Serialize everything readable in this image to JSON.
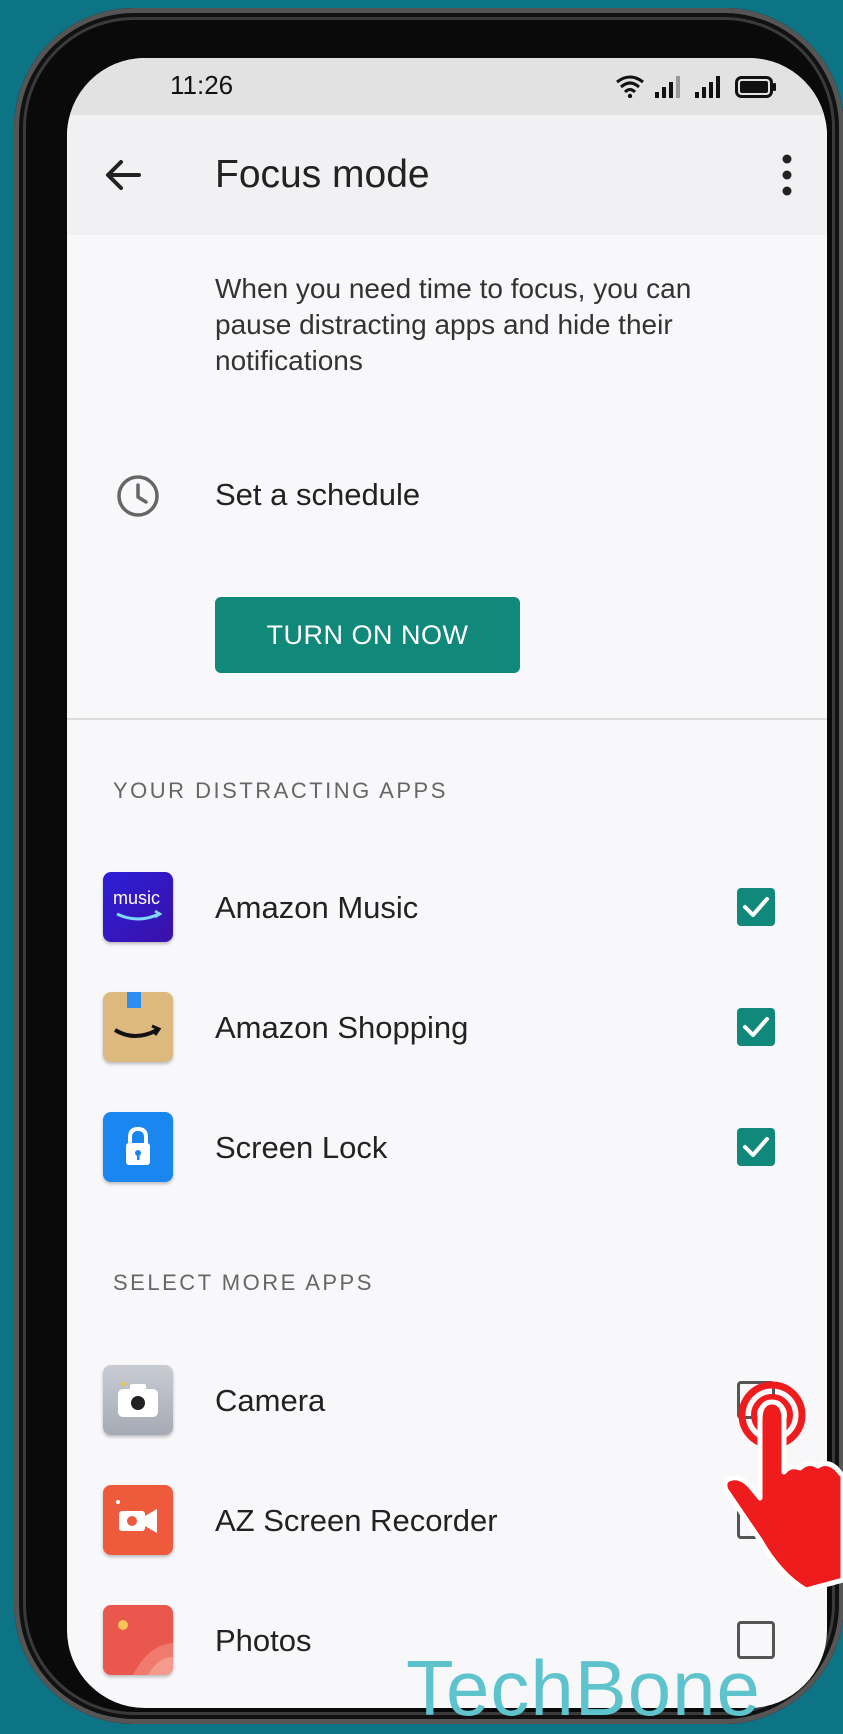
{
  "status_bar": {
    "time": "11:26"
  },
  "app_bar": {
    "title": "Focus mode"
  },
  "intro_text": "When you need time to focus, you can pause distracting apps and hide their notifications",
  "schedule": {
    "label": "Set a schedule"
  },
  "turn_on_button": {
    "label": "TURN ON NOW"
  },
  "distracting_section": {
    "header": "YOUR DISTRACTING APPS",
    "apps": [
      {
        "name": "Amazon Music",
        "checked": true,
        "icon": "amazon-music-icon",
        "icon_text": "music"
      },
      {
        "name": "Amazon Shopping",
        "checked": true,
        "icon": "amazon-shopping-icon"
      },
      {
        "name": "Screen Lock",
        "checked": true,
        "icon": "screen-lock-icon"
      }
    ]
  },
  "more_section": {
    "header": "SELECT MORE APPS",
    "apps": [
      {
        "name": "Camera",
        "checked": false,
        "icon": "camera-icon"
      },
      {
        "name": "AZ Screen Recorder",
        "checked": false,
        "icon": "az-screen-recorder-icon"
      },
      {
        "name": "Photos",
        "checked": false,
        "icon": "photos-icon"
      }
    ]
  },
  "watermark": "TechBone",
  "colors": {
    "accent": "#10887a",
    "background": "#0d7485",
    "hand": "#ee1c1c"
  }
}
